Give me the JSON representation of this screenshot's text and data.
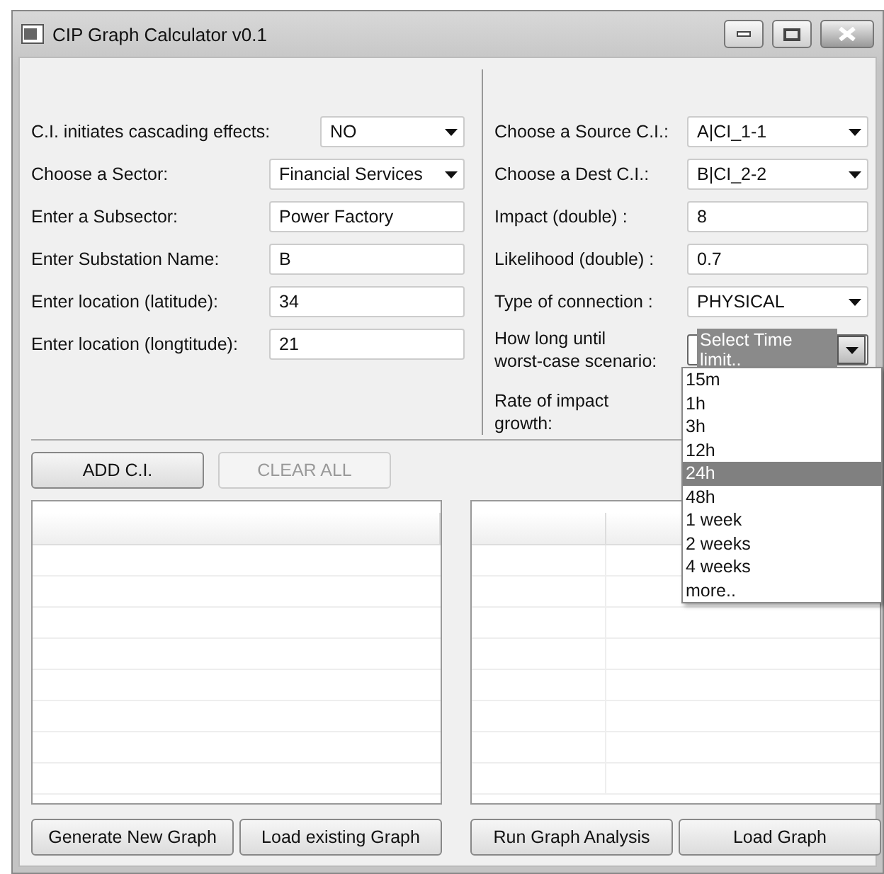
{
  "window": {
    "title": "CIP Graph Calculator v0.1"
  },
  "left_fields": [
    {
      "label": "C.I. initiates cascading effects:",
      "kind": "dropdown",
      "value": "NO"
    },
    {
      "label": "Choose a Sector:",
      "kind": "dropdown",
      "value": "Financial Services"
    },
    {
      "label": "Enter a Subsector:",
      "kind": "text",
      "value": "Power Factory"
    },
    {
      "label": "Enter Substation Name:",
      "kind": "text",
      "value": "B"
    },
    {
      "label": "Enter location (latitude):",
      "kind": "text",
      "value": "34"
    },
    {
      "label": "Enter location (longtitude):",
      "kind": "text",
      "value": "21"
    }
  ],
  "right_fields": [
    {
      "label": "Choose a Source C.I.:",
      "kind": "dropdown",
      "value": "A|CI_1-1"
    },
    {
      "label": "Choose a Dest C.I.:",
      "kind": "dropdown",
      "value": "B|CI_2-2"
    },
    {
      "label": "Impact (double) :",
      "kind": "text",
      "value": "8"
    },
    {
      "label": "Likelihood (double) :",
      "kind": "text",
      "value": "0.7"
    },
    {
      "label": "Type of connection :",
      "kind": "dropdown",
      "value": "PHYSICAL"
    },
    {
      "label": "How long until\nworst-case scenario:",
      "kind": "open_dropdown",
      "value": "Select Time limit.."
    },
    {
      "label": "Rate of impact\ngrowth:",
      "kind": "label"
    }
  ],
  "time_options": [
    {
      "label": "15m",
      "selected": false
    },
    {
      "label": "1h",
      "selected": false
    },
    {
      "label": "3h",
      "selected": false
    },
    {
      "label": "12h",
      "selected": false
    },
    {
      "label": "24h",
      "selected": true
    },
    {
      "label": "48h",
      "selected": false
    },
    {
      "label": "1 week",
      "selected": false
    },
    {
      "label": "2 weeks",
      "selected": false
    },
    {
      "label": "4 weeks",
      "selected": false
    },
    {
      "label": "more..",
      "selected": false
    }
  ],
  "edit_buttons": [
    {
      "label": "ADD C.I.",
      "disabled": false
    },
    {
      "label": "CLEAR ALL",
      "disabled": true
    }
  ],
  "left_buttons": [
    {
      "label": "Generate New Graph"
    },
    {
      "label": "Load existing Graph"
    }
  ],
  "right_buttons": [
    {
      "label": "Run Graph Analysis"
    },
    {
      "label": "Load Graph"
    }
  ]
}
